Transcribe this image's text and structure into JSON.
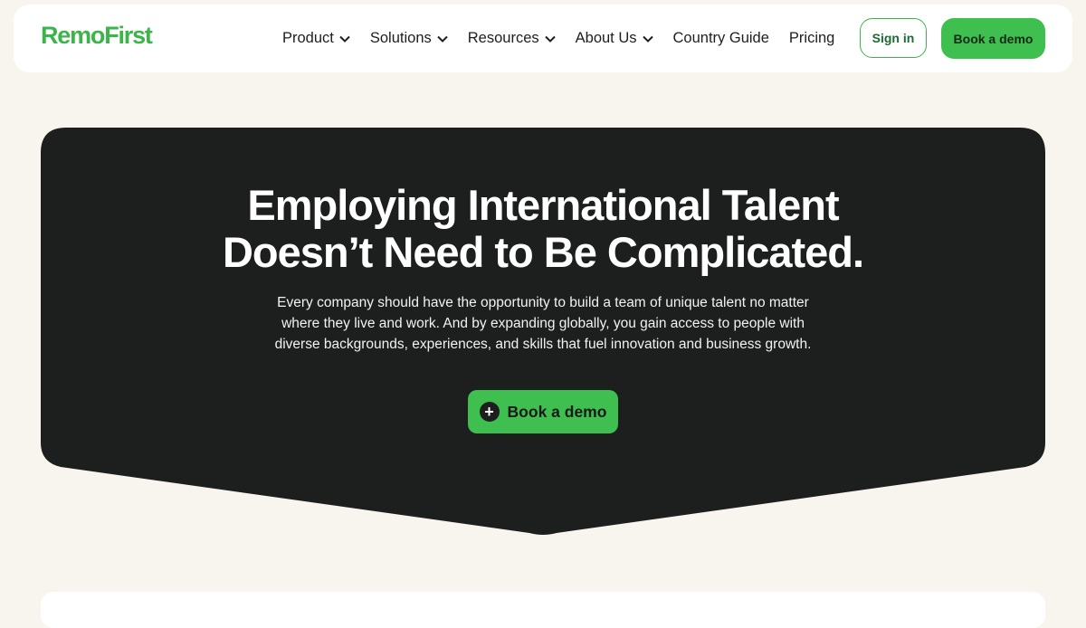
{
  "brand": {
    "logo_text": "RemoFirst",
    "accent_color": "#3fbf4f",
    "dark_color": "#1d1e1e"
  },
  "nav": {
    "items": [
      {
        "label": "Product",
        "has_dropdown": true
      },
      {
        "label": "Solutions",
        "has_dropdown": true
      },
      {
        "label": "Resources",
        "has_dropdown": true
      },
      {
        "label": "About Us",
        "has_dropdown": true
      },
      {
        "label": "Country Guide",
        "has_dropdown": false
      },
      {
        "label": "Pricing",
        "has_dropdown": false
      }
    ],
    "sign_in_label": "Sign in",
    "book_demo_label": "Book a demo"
  },
  "hero": {
    "title_line1": "Employing International Talent",
    "title_line2": "Doesn’t Need to Be Complicated.",
    "subtitle": "Every company should have the opportunity to build a team of unique talent no matter where they live and work. And by expanding globally, you gain access to people with diverse backgrounds, experiences, and skills that fuel innovation and business growth.",
    "cta_label": "Book a demo",
    "cta_icon": "plus-circle-icon"
  }
}
